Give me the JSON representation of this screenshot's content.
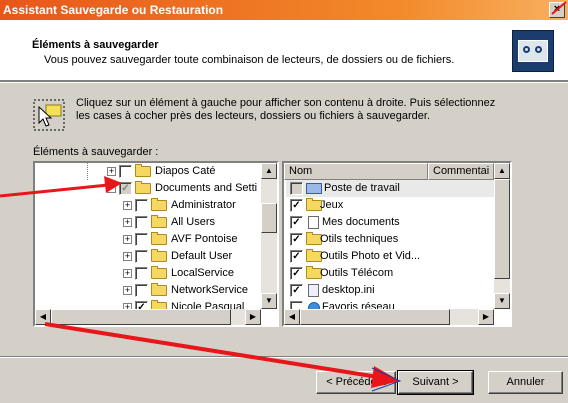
{
  "window": {
    "title": "Assistant Sauvegarde ou Restauration",
    "close_glyph": "×"
  },
  "header": {
    "title": "Éléments à sauvegarder",
    "subtitle": "Vous pouvez sauvegarder toute combinaison de lecteurs, de dossiers ou de fichiers.",
    "icon": "backup-tape-icon"
  },
  "instructions": {
    "line1": "Cliquez sur un élément à gauche pour afficher son contenu à droite. Puis sélectionnez",
    "line2": "les cases à cocher près des lecteurs, dossiers ou fichiers à sauvegarder.",
    "icon": "click-select-icon"
  },
  "list_label": "Éléments à sauvegarder :",
  "tree": {
    "items": [
      {
        "label": "Diapos Caté",
        "check": "",
        "expander": "+"
      },
      {
        "label": "Documents and Setti",
        "check": "✓",
        "expander": "-"
      },
      {
        "label": "Administrator",
        "check": "",
        "expander": "+"
      },
      {
        "label": "All Users",
        "check": "",
        "expander": "+"
      },
      {
        "label": "AVF Pontoise",
        "check": "",
        "expander": "+"
      },
      {
        "label": "Default User",
        "check": "",
        "expander": "+"
      },
      {
        "label": "LocalService",
        "check": "",
        "expander": "+"
      },
      {
        "label": "NetworkService",
        "check": "",
        "expander": "+"
      },
      {
        "label": "Nicole Pasqual",
        "check": "✓",
        "expander": "+"
      }
    ]
  },
  "file_list": {
    "columns": [
      "Nom",
      "Commentai"
    ],
    "items": [
      {
        "label": "Poste de travail",
        "check": "",
        "icon": "computer-icon"
      },
      {
        "label": "Jeux",
        "check": "✓",
        "icon": "folder-icon"
      },
      {
        "label": "Mes documents",
        "check": "✓",
        "icon": "document-icon"
      },
      {
        "label": "Otils techniques",
        "check": "✓",
        "icon": "folder-icon"
      },
      {
        "label": "Outils Photo et Vid...",
        "check": "✓",
        "icon": "folder-icon"
      },
      {
        "label": "Outils Télécom",
        "check": "✓",
        "icon": "folder-icon"
      },
      {
        "label": "desktop.ini",
        "check": "✓",
        "icon": "file-icon"
      },
      {
        "label": "Favoris réseau",
        "check": "",
        "icon": "network-icon"
      }
    ]
  },
  "buttons": {
    "back": "< Précédent",
    "next": "Suivant >",
    "cancel": "Annuler"
  },
  "annotation_color": "#e8161a"
}
